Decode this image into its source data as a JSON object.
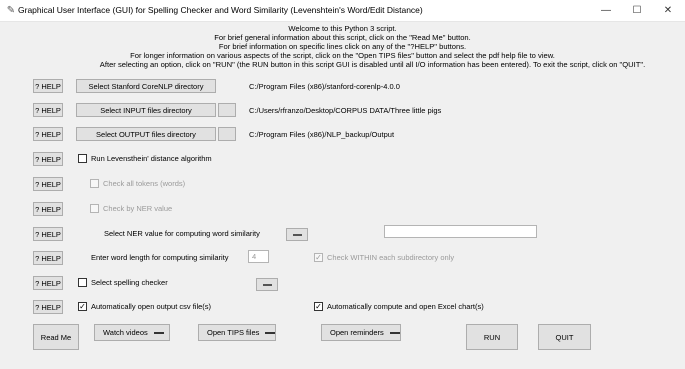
{
  "window": {
    "title": "Graphical User Interface (GUI) for Spelling Checker and Word Similarity (Levenshtein's Word/Edit Distance)",
    "icon": "feather-icon",
    "minimize": "—",
    "maximize": "☐",
    "close": "✕"
  },
  "intro": {
    "line1": "Welcome to this Python 3 script.",
    "line2": "For brief general information about this script, click on the \"Read Me\" button.",
    "line3": "For brief information on specific lines click on any of the \"?HELP\" buttons.",
    "line4": "For longer information on various aspects of the script, click on the \"Open TIPS files\" button and select the pdf help file to view.",
    "line5": "After selecting an option, click on \"RUN\" (the RUN button in this script GUI is disabled until all I/O information has been entered).   To exit the script, click on \"QUIT\"."
  },
  "help_label": "? HELP",
  "dirs": {
    "corenlp": {
      "button": "Select Stanford CoreNLP directory",
      "path": "C:/Program Files (x86)/stanford-corenlp-4.0.0"
    },
    "input": {
      "button": "Select INPUT files directory",
      "path": "C:/Users/rfranzo/Desktop/CORPUS DATA/Three little pigs"
    },
    "output": {
      "button": "Select OUTPUT files directory",
      "path": "C:/Program Files (x86)/NLP_backup/Output"
    }
  },
  "options": {
    "levenshtein": {
      "label": "Run Levensthein' distance algorithm",
      "checked": ""
    },
    "all_tokens": {
      "label": "Check all tokens (words)",
      "checked": ""
    },
    "by_ner": {
      "label": "Check by NER value",
      "checked": ""
    },
    "ner_select": {
      "label": "Select NER value for computing word similarity",
      "value": ""
    },
    "word_length": {
      "label": "Enter word length for computing similarity",
      "value": "4"
    },
    "within_subdir": {
      "label": "Check WITHIN each subdirectory only",
      "checked": "✓"
    },
    "spelling": {
      "label": "Select spelling checker",
      "checked": ""
    },
    "open_csv": {
      "label": "Automatically open output csv file(s)",
      "checked": "✓"
    },
    "excel_chart": {
      "label": "Automatically compute and open Excel chart(s)",
      "checked": "✓"
    }
  },
  "bottom": {
    "read_me": "Read Me",
    "watch_videos": "Watch videos",
    "open_tips": "Open TIPS files",
    "open_reminders": "Open reminders",
    "run": "RUN",
    "quit": "QUIT"
  }
}
